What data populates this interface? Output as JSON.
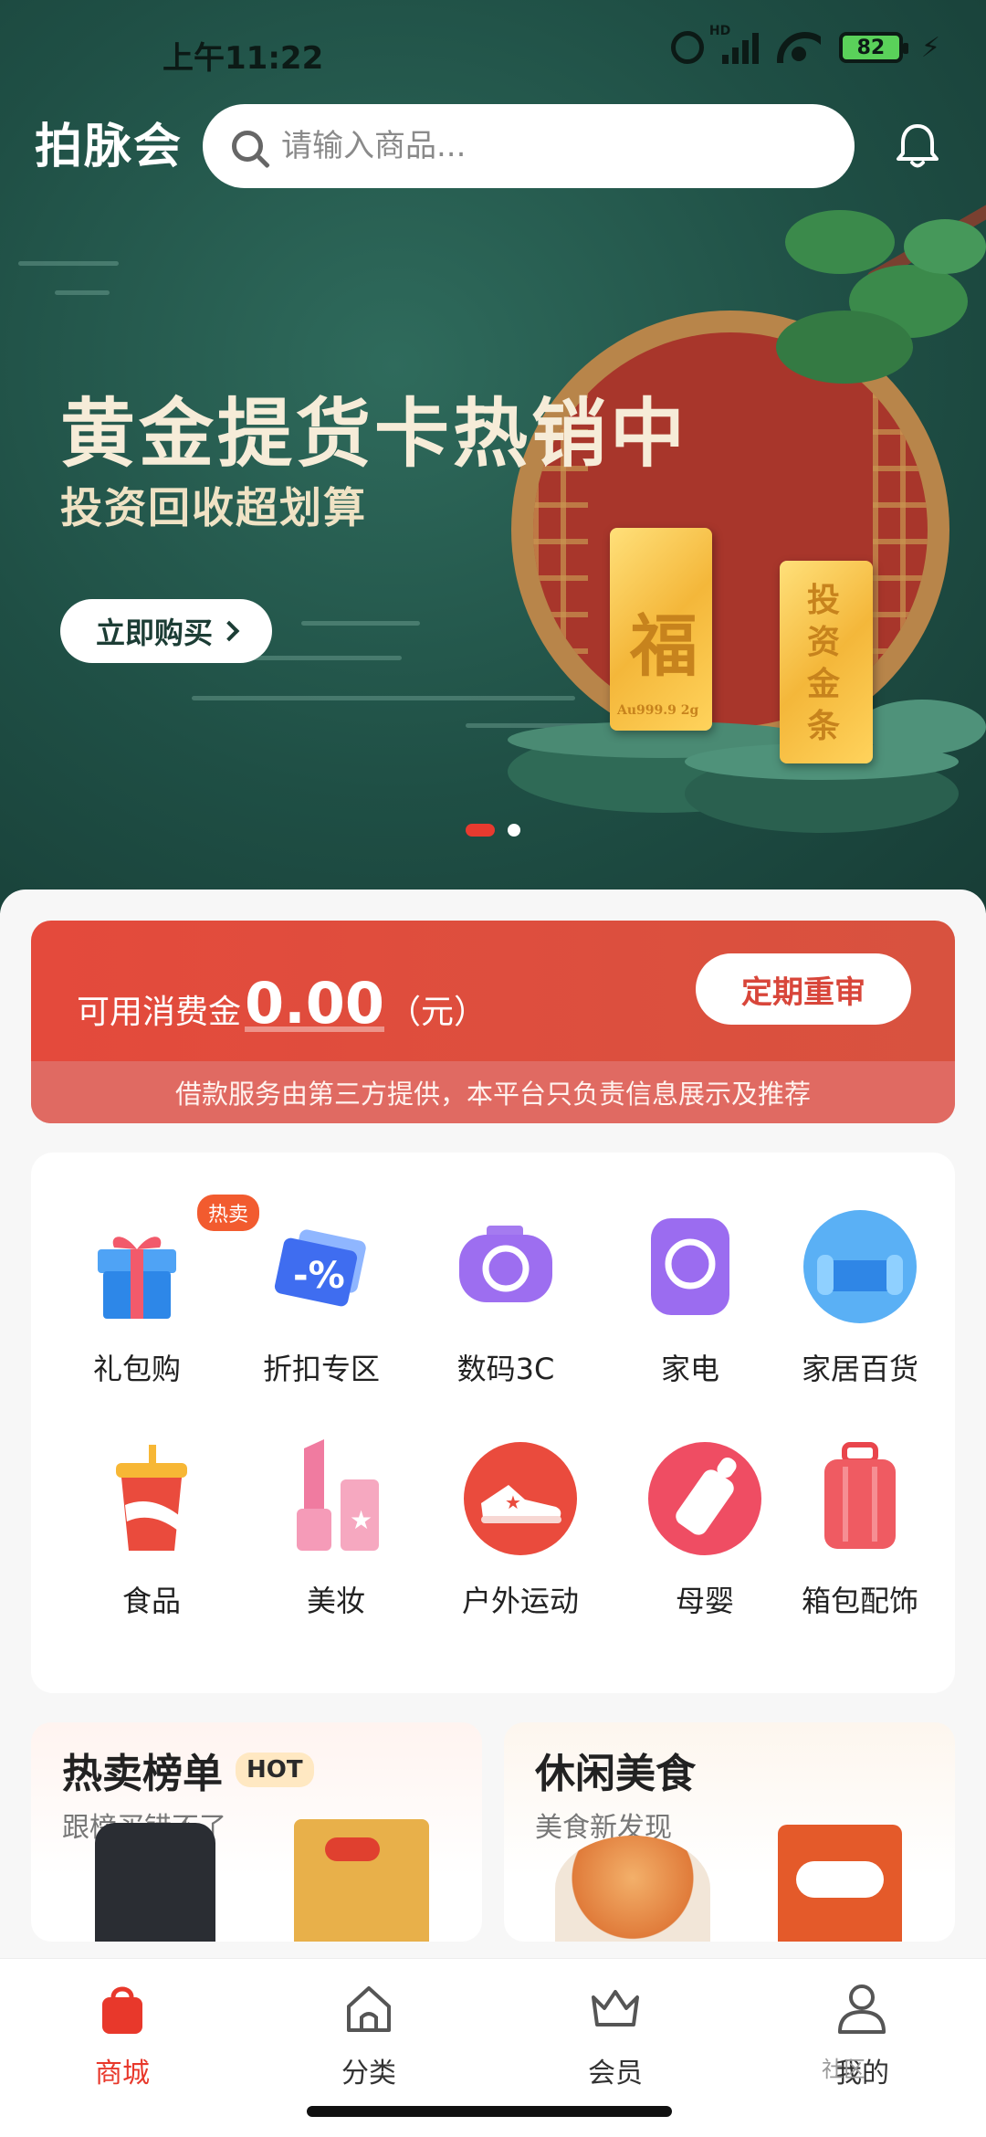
{
  "status_bar": {
    "time": "上午11:22",
    "network": "HD",
    "battery": "82"
  },
  "header": {
    "brand": "拍脉会",
    "search_placeholder": "请输入商品..."
  },
  "banner": {
    "title": "黄金提货卡热销中",
    "subtitle": "投资回收超划算",
    "button_label": "立即购买",
    "gold_bar_left_char": "福",
    "gold_bar_left_mark": "Au999.9 2g",
    "gold_bar_right_text": "投资金条",
    "active_slide": 1,
    "slide_count": 2
  },
  "credit": {
    "label": "可用消费金",
    "amount": "0.00",
    "unit": "（元）",
    "button_label": "定期重审",
    "disclaimer": "借款服务由第三方提供，本平台只负责信息展示及推荐"
  },
  "categories": [
    {
      "label": "礼包购",
      "icon": "gift-icon",
      "badge": "热卖"
    },
    {
      "label": "折扣专区",
      "icon": "discount-icon",
      "icon_text": "-%"
    },
    {
      "label": "数码3C",
      "icon": "camera-icon"
    },
    {
      "label": "家电",
      "icon": "appliance-icon"
    },
    {
      "label": "家居百货",
      "icon": "sofa-icon"
    },
    {
      "label": "食品",
      "icon": "drink-cup-icon"
    },
    {
      "label": "美妆",
      "icon": "lipstick-icon"
    },
    {
      "label": "户外运动",
      "icon": "sneaker-icon"
    },
    {
      "label": "母婴",
      "icon": "baby-bottle-icon"
    },
    {
      "label": "箱包配饰",
      "icon": "suitcase-icon"
    }
  ],
  "promos": [
    {
      "title": "热卖榜单",
      "badge": "HOT",
      "subtitle": "跟榜买错不了"
    },
    {
      "title": "休闲美食",
      "subtitle": "美食新发现"
    }
  ],
  "tabbar": [
    {
      "label": "商城",
      "icon": "shopping-bag-icon",
      "active": true
    },
    {
      "label": "分类",
      "icon": "home-icon",
      "active": false
    },
    {
      "label": "会员",
      "icon": "crown-icon",
      "active": false
    },
    {
      "label": "我的",
      "icon": "user-icon",
      "active": false
    }
  ],
  "watermark": "社区",
  "colors": {
    "accent": "#e8382b",
    "banner_bg": "#1f4f45",
    "credit_bg": "#e44a3c"
  }
}
